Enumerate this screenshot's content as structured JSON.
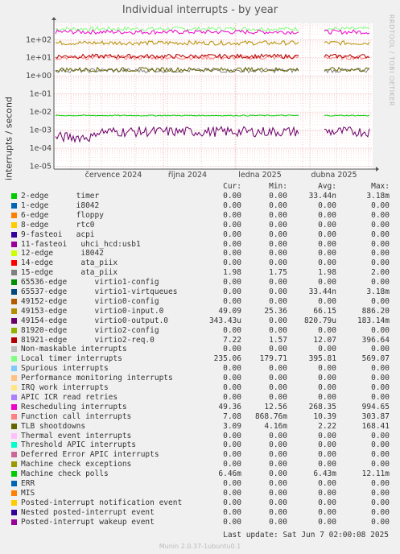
{
  "title": "Individual interrupts - by year",
  "vertical_label": "interrupts / second",
  "side_brand": "RRDTOOL / TOBI OETIKER",
  "legend_headers": {
    "cur": "Cur:",
    "min": "Min:",
    "avg": "Avg:",
    "max": "Max:"
  },
  "legend": [
    {
      "name": "2-edge      timer",
      "color": "#00cc00",
      "cur": "0.00",
      "min": "0.00",
      "avg": "33.44n",
      "max": "3.18m"
    },
    {
      "name": "1-edge      i8042",
      "color": "#0066b3",
      "cur": "0.00",
      "min": "0.00",
      "avg": "0.00",
      "max": "0.00"
    },
    {
      "name": "6-edge      floppy",
      "color": "#ff8000",
      "cur": "0.00",
      "min": "0.00",
      "avg": "0.00",
      "max": "0.00"
    },
    {
      "name": "8-edge      rtc0",
      "color": "#ffcc00",
      "cur": "0.00",
      "min": "0.00",
      "avg": "0.00",
      "max": "0.00"
    },
    {
      "name": "9-fasteoi   acpi",
      "color": "#330099",
      "cur": "0.00",
      "min": "0.00",
      "avg": "0.00",
      "max": "0.00"
    },
    {
      "name": "11-fasteoi   uhci_hcd:usb1",
      "color": "#990099",
      "cur": "0.00",
      "min": "0.00",
      "avg": "0.00",
      "max": "0.00"
    },
    {
      "name": "12-edge      i8042",
      "color": "#ccff00",
      "cur": "0.00",
      "min": "0.00",
      "avg": "0.00",
      "max": "0.00"
    },
    {
      "name": "14-edge      ata_piix",
      "color": "#ff0000",
      "cur": "0.00",
      "min": "0.00",
      "avg": "0.00",
      "max": "0.00"
    },
    {
      "name": "15-edge      ata_piix",
      "color": "#808080",
      "cur": "1.98",
      "min": "1.75",
      "avg": "1.98",
      "max": "2.00"
    },
    {
      "name": "65536-edge      virtio1-config",
      "color": "#008f00",
      "cur": "0.00",
      "min": "0.00",
      "avg": "0.00",
      "max": "0.00"
    },
    {
      "name": "65537-edge      virtio1-virtqueues",
      "color": "#00487d",
      "cur": "0.00",
      "min": "0.00",
      "avg": "33.44n",
      "max": "3.18m"
    },
    {
      "name": "49152-edge      virtio0-config",
      "color": "#b35a00",
      "cur": "0.00",
      "min": "0.00",
      "avg": "0.00",
      "max": "0.00"
    },
    {
      "name": "49153-edge      virtio0-input.0",
      "color": "#b38f00",
      "cur": "49.09",
      "min": "25.36",
      "avg": "66.15",
      "max": "886.20"
    },
    {
      "name": "49154-edge      virtio0-output.0",
      "color": "#6b006b",
      "cur": "343.43u",
      "min": "0.00",
      "avg": "820.79u",
      "max": "183.14m"
    },
    {
      "name": "81920-edge      virtio2-config",
      "color": "#8fb300",
      "cur": "0.00",
      "min": "0.00",
      "avg": "0.00",
      "max": "0.00"
    },
    {
      "name": "81921-edge      virtio2-req.0",
      "color": "#b30000",
      "cur": "7.22",
      "min": "1.57",
      "avg": "12.07",
      "max": "396.64"
    },
    {
      "name": "Non-maskable interrupts",
      "color": "#bebebe",
      "cur": "0.00",
      "min": "0.00",
      "avg": "0.00",
      "max": "0.00"
    },
    {
      "name": "Local timer interrupts",
      "color": "#80ff80",
      "cur": "235.06",
      "min": "179.71",
      "avg": "395.81",
      "max": "569.07"
    },
    {
      "name": "Spurious interrupts",
      "color": "#80c9ff",
      "cur": "0.00",
      "min": "0.00",
      "avg": "0.00",
      "max": "0.00"
    },
    {
      "name": "Performance monitoring interrupts",
      "color": "#ffc080",
      "cur": "0.00",
      "min": "0.00",
      "avg": "0.00",
      "max": "0.00"
    },
    {
      "name": "IRQ work interrupts",
      "color": "#ffe680",
      "cur": "0.00",
      "min": "0.00",
      "avg": "0.00",
      "max": "0.00"
    },
    {
      "name": "APIC ICR read retries",
      "color": "#aa80ff",
      "cur": "0.00",
      "min": "0.00",
      "avg": "0.00",
      "max": "0.00"
    },
    {
      "name": "Rescheduling interrupts",
      "color": "#ee00cc",
      "cur": "49.36",
      "min": "12.56",
      "avg": "268.35",
      "max": "994.65"
    },
    {
      "name": "Function call interrupts",
      "color": "#ff8080",
      "cur": "7.08",
      "min": "868.76m",
      "avg": "10.39",
      "max": "303.87"
    },
    {
      "name": "TLB shootdowns",
      "color": "#666600",
      "cur": "3.09",
      "min": "4.16m",
      "avg": "2.22",
      "max": "168.41"
    },
    {
      "name": "Thermal event interrupts",
      "color": "#ffbfff",
      "cur": "0.00",
      "min": "0.00",
      "avg": "0.00",
      "max": "0.00"
    },
    {
      "name": "Threshold APIC interrupts",
      "color": "#00ffcc",
      "cur": "0.00",
      "min": "0.00",
      "avg": "0.00",
      "max": "0.00"
    },
    {
      "name": "Deferred Error APIC interrupts",
      "color": "#cc6699",
      "cur": "0.00",
      "min": "0.00",
      "avg": "0.00",
      "max": "0.00"
    },
    {
      "name": "Machine check exceptions",
      "color": "#999900",
      "cur": "0.00",
      "min": "0.00",
      "avg": "0.00",
      "max": "0.00"
    },
    {
      "name": "Machine check polls",
      "color": "#00cc00",
      "cur": "6.46m",
      "min": "0.00",
      "avg": "6.43m",
      "max": "12.11m"
    },
    {
      "name": "ERR",
      "color": "#0066b3",
      "cur": "0.00",
      "min": "0.00",
      "avg": "0.00",
      "max": "0.00"
    },
    {
      "name": "MIS",
      "color": "#ff8000",
      "cur": "0.00",
      "min": "0.00",
      "avg": "0.00",
      "max": "0.00"
    },
    {
      "name": "Posted-interrupt notification event",
      "color": "#ffcc00",
      "cur": "0.00",
      "min": "0.00",
      "avg": "0.00",
      "max": "0.00"
    },
    {
      "name": "Nested posted-interrupt event",
      "color": "#330099",
      "cur": "0.00",
      "min": "0.00",
      "avg": "0.00",
      "max": "0.00"
    },
    {
      "name": "Posted-interrupt wakeup event",
      "color": "#990099",
      "cur": "0.00",
      "min": "0.00",
      "avg": "0.00",
      "max": "0.00"
    }
  ],
  "last_update": "Last update: Sat Jun  7 02:00:08 2025",
  "munin_version": "Munin 2.0.37-1ubuntu0.1",
  "chart_data": {
    "type": "line",
    "title": "Individual interrupts - by year",
    "ylabel": "interrupts / second",
    "yscale": "log",
    "ylim": [
      7e-06,
      800
    ],
    "y_ticks": [
      "1e-05",
      "1e-04",
      "1e-03",
      "1e-02",
      "1e-01",
      "1e+00",
      "1e+01",
      "1e+02"
    ],
    "x_ticks": [
      "července 2024",
      "října 2024",
      "ledna 2025",
      "dubna 2025"
    ],
    "grid": true,
    "gap": [
      "mid-March 2025",
      "late March 2025"
    ],
    "series": [
      {
        "name": "Local timer interrupts",
        "color": "#80ff80",
        "level": 395.81
      },
      {
        "name": "Rescheduling interrupts",
        "color": "#ee00cc",
        "level": 268.35
      },
      {
        "name": "49153-edge virtio0-input.0",
        "color": "#b38f00",
        "level": 66.15
      },
      {
        "name": "Function call interrupts",
        "color": "#ff8080",
        "level": 10.39
      },
      {
        "name": "81921-edge virtio2-req.0",
        "color": "#b30000",
        "level": 12.07
      },
      {
        "name": "15-edge ata_piix",
        "color": "#808080",
        "level": 1.98
      },
      {
        "name": "TLB shootdowns",
        "color": "#666600",
        "level": 2.22
      },
      {
        "name": "Machine check polls",
        "color": "#00cc00",
        "level": 0.00643
      },
      {
        "name": "49154-edge virtio0-output.0",
        "color": "#6b006b",
        "level": 0.00082
      }
    ]
  }
}
